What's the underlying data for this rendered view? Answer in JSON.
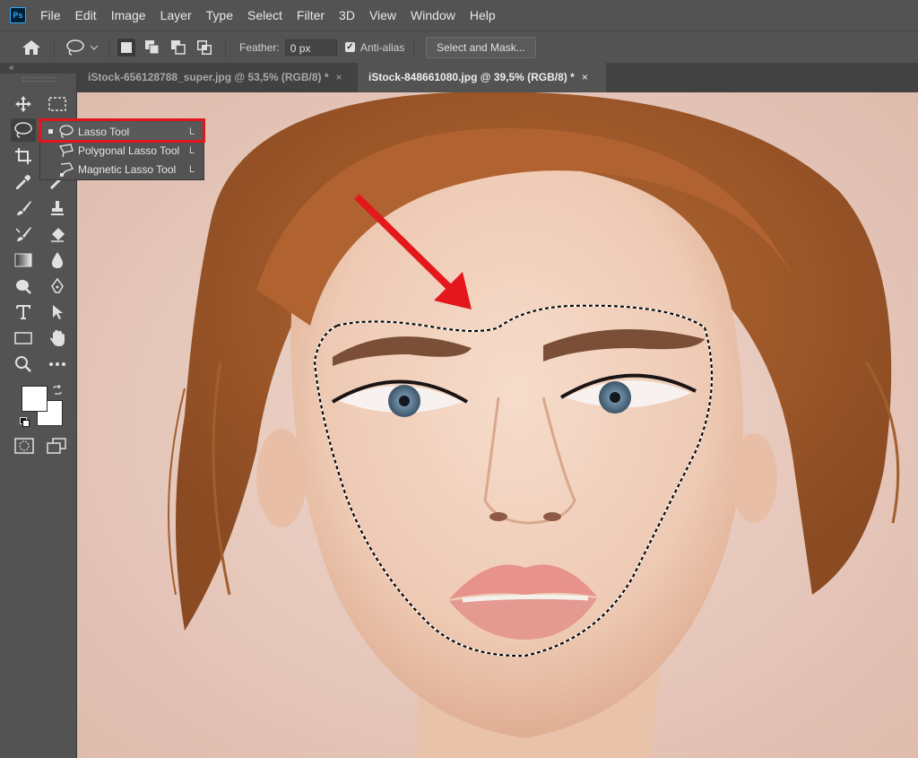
{
  "app": {
    "logo_text": "Ps",
    "menu": [
      "File",
      "Edit",
      "Image",
      "Layer",
      "Type",
      "Select",
      "Filter",
      "3D",
      "View",
      "Window",
      "Help"
    ]
  },
  "options_bar": {
    "feather_label": "Feather:",
    "feather_value": "0 px",
    "anti_alias_label": "Anti-alias",
    "anti_alias_checked": true,
    "select_mask_label": "Select and Mask..."
  },
  "tabs": [
    {
      "label": "iStock-656128788_super.jpg @ 53,5% (RGB/8) *",
      "close": "×",
      "active": false
    },
    {
      "label": "iStock-848661080.jpg @ 39,5% (RGB/8) *",
      "close": "×",
      "active": true
    }
  ],
  "toolbar": {
    "collapse_glyph": "«",
    "foreground_color": "#ffffff",
    "background_color": "#ffffff"
  },
  "lasso_flyout": {
    "items": [
      {
        "label": "Lasso Tool",
        "shortcut": "L",
        "icon": "lasso-icon",
        "active": true
      },
      {
        "label": "Polygonal Lasso Tool",
        "shortcut": "L",
        "icon": "polygonal-lasso-icon",
        "active": false
      },
      {
        "label": "Magnetic Lasso Tool",
        "shortcut": "L",
        "icon": "magnetic-lasso-icon",
        "active": false
      }
    ]
  },
  "colors": {
    "ui_bg": "#535353",
    "ui_dark": "#424242",
    "highlight": "#e2161b",
    "arrow": "#e4181c"
  }
}
